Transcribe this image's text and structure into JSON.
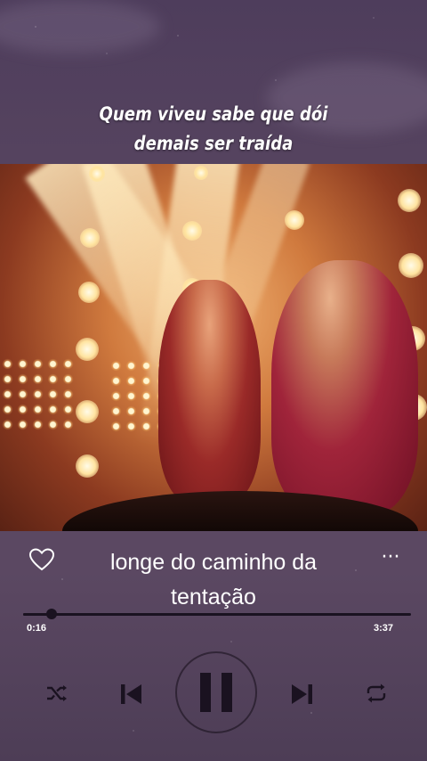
{
  "lyrics": {
    "top_line_1": "Quem viveu sabe que dói",
    "top_line_2": "demais ser traída",
    "current_line_1": "longe do caminho da",
    "current_line_2": "tentação"
  },
  "player": {
    "elapsed": "0:16",
    "duration": "3:37",
    "progress_fraction": 0.074,
    "state": "playing",
    "more_label": "···"
  },
  "icons": {
    "like": "heart-outline-icon",
    "more": "more-horizontal-icon",
    "shuffle": "shuffle-icon",
    "previous": "skip-previous-icon",
    "pause": "pause-icon",
    "next": "skip-next-icon",
    "repeat": "repeat-icon"
  },
  "colors": {
    "background": "#56445f",
    "control_dark": "#1a1220",
    "text": "#ffffff"
  }
}
